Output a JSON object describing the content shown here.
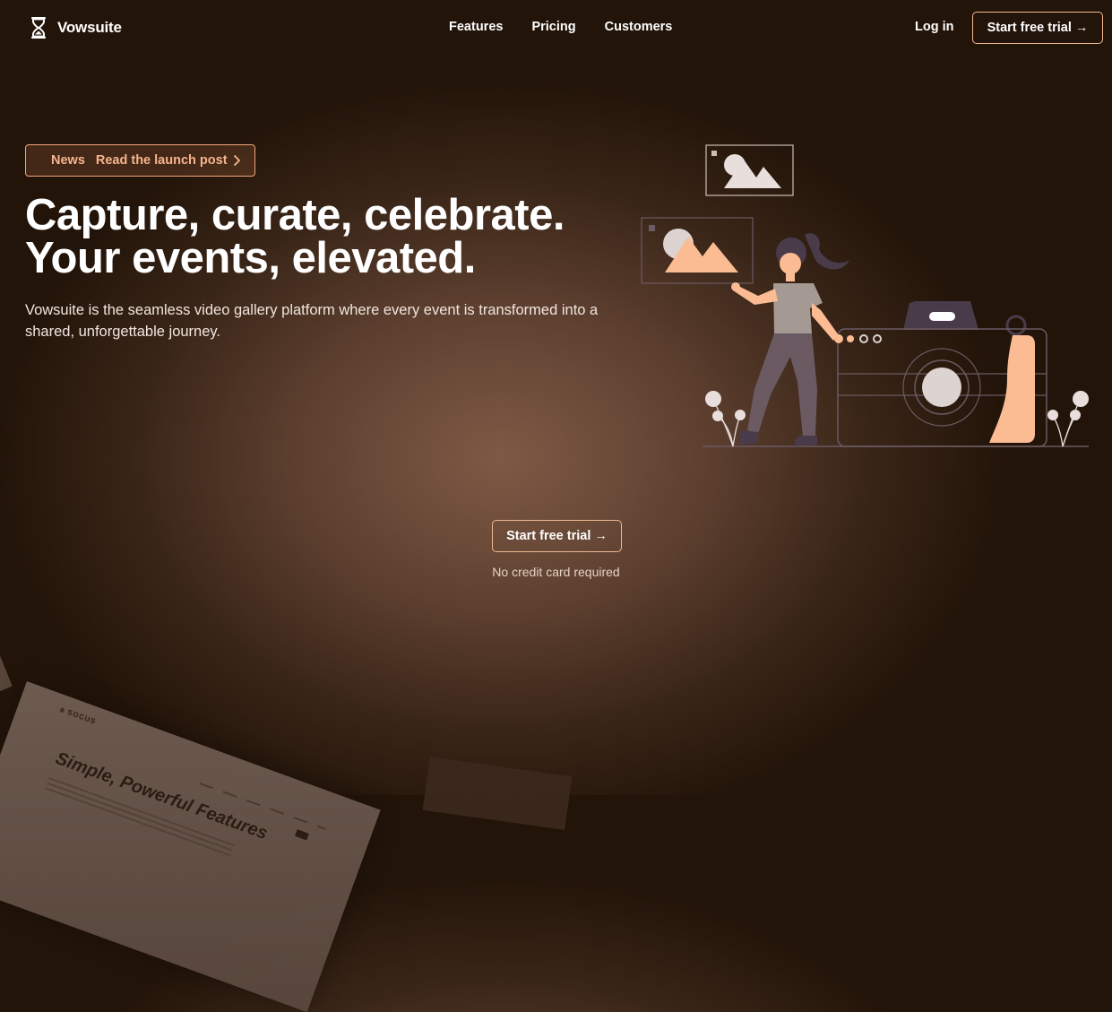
{
  "brand": {
    "name": "Vowsuite",
    "icon": "hourglass-icon"
  },
  "nav": {
    "items": [
      {
        "label": "Features"
      },
      {
        "label": "Pricing"
      },
      {
        "label": "Customers"
      }
    ],
    "login_label": "Log in",
    "trial_label": "Start free trial →"
  },
  "hero": {
    "news_tag": "News",
    "news_link": "Read the launch post",
    "news_icon": "chevron-right-icon",
    "headline_line1": "Capture, curate, celebrate.",
    "headline_line2": "Your events, elevated.",
    "subtext": "Vowsuite is the seamless video gallery platform where every event is transformed into a shared, unforgettable journey.",
    "cta_label": "Start free trial →",
    "cta_note": "No credit card required"
  },
  "preview": {
    "brand": "ꞩ SOCUS",
    "title": "Simple, Powerful Features"
  },
  "colors": {
    "accent": "#f0b78e",
    "accent_fill": "#fbbc94",
    "background_dark": "#231409",
    "background_glow": "#7e5a45",
    "illustration_stroke": "#6b5a62"
  }
}
